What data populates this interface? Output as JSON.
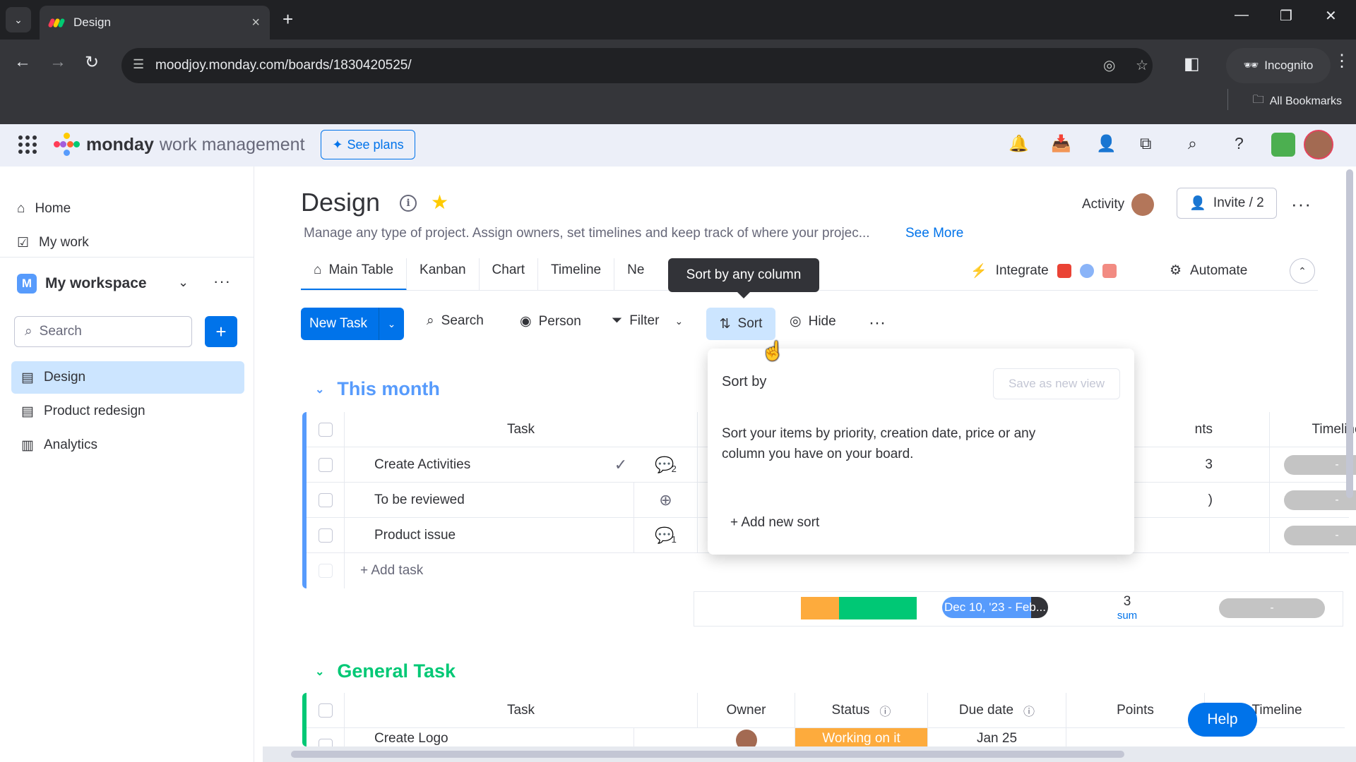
{
  "browser": {
    "tab_title": "Design",
    "url": "moodjoy.monday.com/boards/1830420525/",
    "incognito_label": "Incognito",
    "bookmarks_label": "All Bookmarks"
  },
  "app": {
    "logo_bold": "monday",
    "logo_rest": "work management",
    "see_plans": "See plans"
  },
  "sidebar": {
    "home": "Home",
    "my_work": "My work",
    "workspace_initial": "M",
    "workspace_name": "My workspace",
    "search_placeholder": "Search",
    "boards": [
      {
        "label": "Design",
        "active": true
      },
      {
        "label": "Product redesign",
        "active": false
      },
      {
        "label": "Analytics",
        "active": false
      }
    ]
  },
  "board": {
    "title": "Design",
    "description": "Manage any type of project. Assign owners, set timelines and keep track of where your projec...",
    "see_more": "See More",
    "activity": "Activity",
    "invite": "Invite / 2",
    "views": [
      "Main Table",
      "Kanban",
      "Chart",
      "Timeline",
      "Ne"
    ],
    "integrate": "Integrate",
    "automate": "Automate",
    "tooltip": "Sort by any column"
  },
  "toolbar": {
    "new_task": "New Task",
    "search": "Search",
    "person": "Person",
    "filter": "Filter",
    "sort": "Sort",
    "hide": "Hide"
  },
  "groups": [
    {
      "title": "This month",
      "color": "#579bfc",
      "task_header": "Task",
      "points_header_fragment": "nts",
      "timeline_header": "Timeline",
      "rows": [
        {
          "task": "Create Activities",
          "update_count": "2",
          "points_fragment": "3",
          "timeline": "-"
        },
        {
          "task": "To be reviewed",
          "update_count": "",
          "points_fragment": ")",
          "timeline": "-"
        },
        {
          "task": "Product issue",
          "update_count": "1",
          "points_fragment": "",
          "timeline": "-"
        }
      ],
      "add_task": "+ Add task",
      "summary": {
        "date_range": "Dec 10, '23 - Feb...",
        "points_sum": "3",
        "points_label": "sum",
        "timeline": "-"
      }
    },
    {
      "title": "General Task",
      "color": "#00c875",
      "headers": {
        "task": "Task",
        "owner": "Owner",
        "status": "Status",
        "due_date": "Due date",
        "points": "Points",
        "timeline": "Timeline"
      },
      "rows": [
        {
          "task": "Create Logo",
          "status": "Working on it",
          "due_date": "Jan 25"
        }
      ]
    }
  ],
  "sort_popover": {
    "title": "Sort by",
    "save_view": "Save as new view",
    "description": "Sort your items by priority, creation date, price or any column you have on your board.",
    "add_sort": "+ Add new sort"
  },
  "help": "Help",
  "colors": {
    "accent": "#0073ea",
    "status_working": "#fdab3d",
    "status_done": "#00c875",
    "group_blue": "#579bfc",
    "group_green": "#00c875"
  }
}
